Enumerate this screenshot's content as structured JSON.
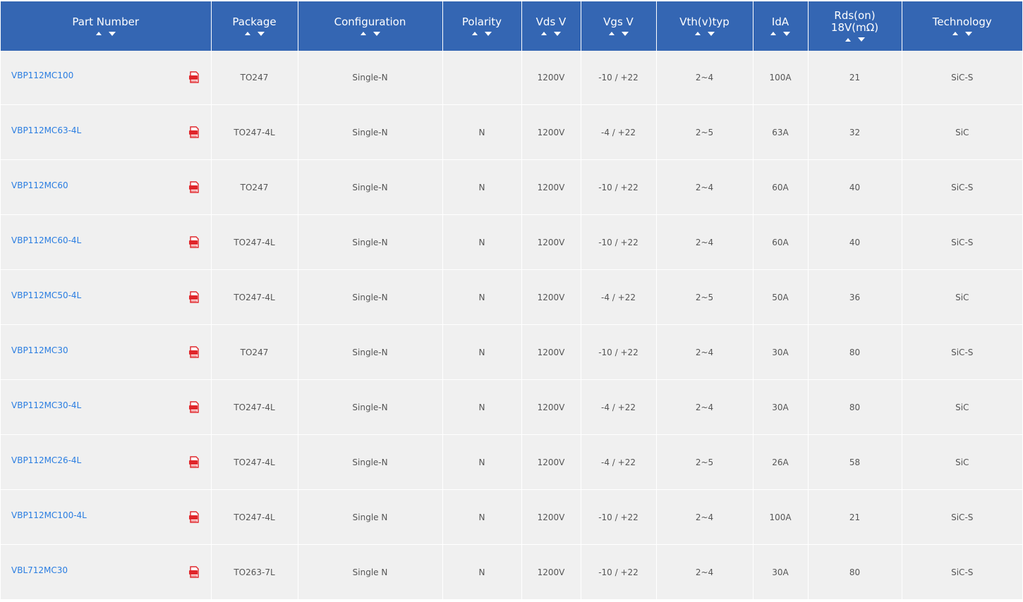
{
  "table": {
    "headers": [
      {
        "label": "Part Number"
      },
      {
        "label": "Package"
      },
      {
        "label": "Configuration"
      },
      {
        "label": "Polarity"
      },
      {
        "label": "Vds V"
      },
      {
        "label": "Vgs V"
      },
      {
        "label": "Vth(v)typ"
      },
      {
        "label": "IdA"
      },
      {
        "label": "Rds(on) 18V(mΩ)"
      },
      {
        "label": "Technology"
      }
    ],
    "rows": [
      {
        "part": "VBP112MC100",
        "package": "TO247",
        "config": "Single-N",
        "polarity": "",
        "vds": "1200V",
        "vgs": "-10 / +22",
        "vth": "2~4",
        "id": "100A",
        "rds": "21",
        "tech": "SiC-S"
      },
      {
        "part": "VBP112MC63-4L",
        "package": "TO247-4L",
        "config": "Single-N",
        "polarity": "N",
        "vds": "1200V",
        "vgs": "-4 / +22",
        "vth": "2~5",
        "id": "63A",
        "rds": "32",
        "tech": "SiC"
      },
      {
        "part": "VBP112MC60",
        "package": "TO247",
        "config": "Single-N",
        "polarity": "N",
        "vds": "1200V",
        "vgs": "-10 / +22",
        "vth": "2~4",
        "id": "60A",
        "rds": "40",
        "tech": "SiC-S"
      },
      {
        "part": "VBP112MC60-4L",
        "package": "TO247-4L",
        "config": "Single-N",
        "polarity": "N",
        "vds": "1200V",
        "vgs": "-10 / +22",
        "vth": "2~4",
        "id": "60A",
        "rds": "40",
        "tech": "SiC-S"
      },
      {
        "part": "VBP112MC50-4L",
        "package": "TO247-4L",
        "config": "Single-N",
        "polarity": "N",
        "vds": "1200V",
        "vgs": "-4 / +22",
        "vth": "2~5",
        "id": "50A",
        "rds": "36",
        "tech": "SiC"
      },
      {
        "part": "VBP112MC30",
        "package": "TO247",
        "config": "Single-N",
        "polarity": "N",
        "vds": "1200V",
        "vgs": "-10 / +22",
        "vth": "2~4",
        "id": "30A",
        "rds": "80",
        "tech": "SiC-S"
      },
      {
        "part": "VBP112MC30-4L",
        "package": "TO247-4L",
        "config": "Single-N",
        "polarity": "N",
        "vds": "1200V",
        "vgs": "-4 / +22",
        "vth": "2~4",
        "id": "30A",
        "rds": "80",
        "tech": "SiC"
      },
      {
        "part": "VBP112MC26-4L",
        "package": "TO247-4L",
        "config": "Single-N",
        "polarity": "N",
        "vds": "1200V",
        "vgs": "-4 / +22",
        "vth": "2~5",
        "id": "26A",
        "rds": "58",
        "tech": "SiC"
      },
      {
        "part": "VBP112MC100-4L",
        "package": "TO247-4L",
        "config": "Single N",
        "polarity": "N",
        "vds": "1200V",
        "vgs": "-10 / +22",
        "vth": "2~4",
        "id": "100A",
        "rds": "21",
        "tech": "SiC-S"
      },
      {
        "part": "VBL712MC30",
        "package": "TO263-7L",
        "config": "Single N",
        "polarity": "N",
        "vds": "1200V",
        "vgs": "-10 / +22",
        "vth": "2~4",
        "id": "30A",
        "rds": "80",
        "tech": "SiC-S"
      }
    ]
  },
  "icons": {
    "sort": "sort-arrows-icon",
    "datasheet": "pdf-icon"
  },
  "colors": {
    "header_bg": "#3466b3",
    "row_bg": "#f0f0f0",
    "link": "#2a7de1",
    "pdf_red": "#e0262b"
  }
}
